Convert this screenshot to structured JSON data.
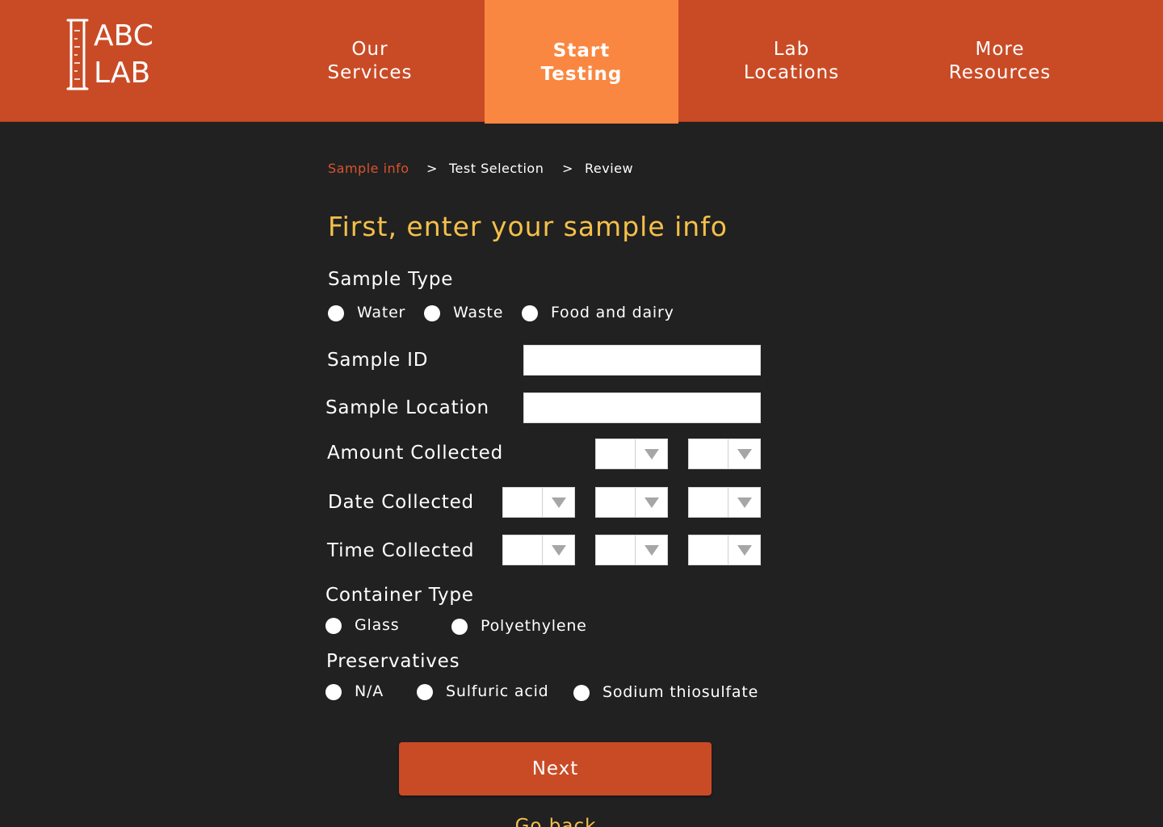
{
  "logo": {
    "line1": "ABC",
    "line2": "LAB",
    "icon": "graduated-cylinder-icon"
  },
  "nav": {
    "items": [
      {
        "label": "Our\nServices",
        "active": false
      },
      {
        "label": "Start\nTesting",
        "active": true
      },
      {
        "label": "Lab\nLocations",
        "active": false
      },
      {
        "label": "More\nResources",
        "active": false
      }
    ]
  },
  "breadcrumb": {
    "steps": [
      "Sample info",
      "Test Selection",
      "Review"
    ],
    "separator": ">"
  },
  "form": {
    "title": "First, enter your sample info",
    "sample_type": {
      "label": "Sample Type",
      "options": [
        "Water",
        "Waste",
        "Food and dairy"
      ]
    },
    "sample_id": {
      "label": "Sample ID",
      "value": ""
    },
    "sample_location": {
      "label": "Sample Location",
      "value": ""
    },
    "amount_collected": {
      "label": "Amount Collected"
    },
    "date_collected": {
      "label": "Date Collected"
    },
    "time_collected": {
      "label": "Time Collected"
    },
    "container_type": {
      "label": "Container Type",
      "options": [
        "Glass",
        "Polyethylene"
      ]
    },
    "preservatives": {
      "label": "Preservatives",
      "options": [
        "N/A",
        "Sulfuric acid",
        "Sodium thiosulfate"
      ]
    }
  },
  "actions": {
    "next_label": "Next",
    "back_label": "Go back"
  },
  "colors": {
    "header": "#c94b26",
    "active_tab": "#fa8741",
    "background": "#212121",
    "title": "#f5c04a",
    "current_step": "#d9542d"
  }
}
